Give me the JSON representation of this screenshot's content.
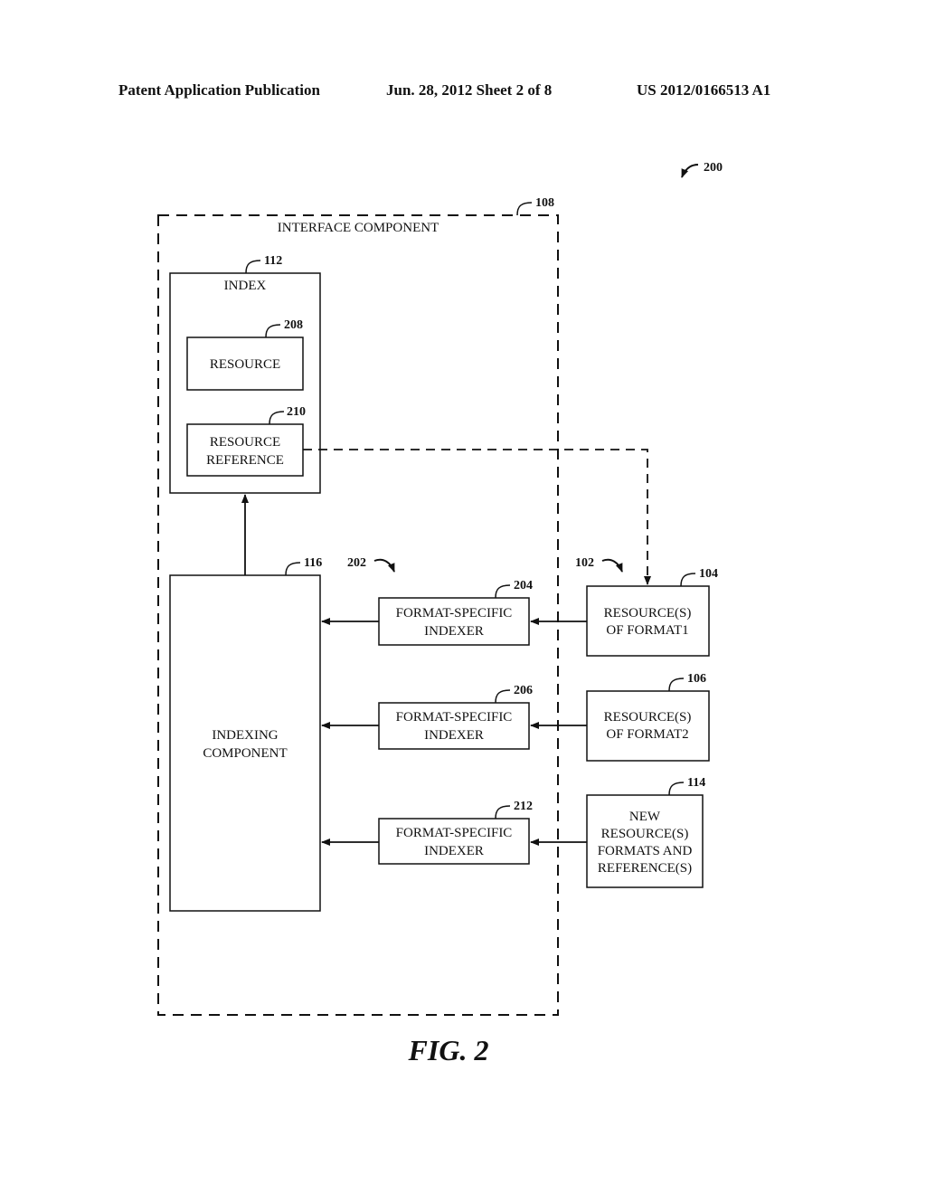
{
  "header": {
    "left": "Patent Application Publication",
    "middle": "Jun. 28, 2012  Sheet 2 of 8",
    "right": "US 2012/0166513 A1"
  },
  "figure": {
    "ref": "200",
    "caption": "FIG. 2",
    "interface_component": {
      "label": "INTERFACE COMPONENT",
      "ref": "108"
    },
    "index": {
      "label": "INDEX",
      "ref": "112"
    },
    "resource": {
      "label": "RESOURCE",
      "ref": "208"
    },
    "resource_reference": {
      "line1": "RESOURCE",
      "line2": "REFERENCE",
      "ref": "210"
    },
    "indexing_component": {
      "line1": "INDEXING",
      "line2": "COMPONENT",
      "ref": "116"
    },
    "indexer_group_ref": "202",
    "resource_group_ref": "102",
    "indexers": [
      {
        "line1": "FORMAT-SPECIFIC",
        "line2": "INDEXER",
        "ref": "204"
      },
      {
        "line1": "FORMAT-SPECIFIC",
        "line2": "INDEXER",
        "ref": "206"
      },
      {
        "line1": "FORMAT-SPECIFIC",
        "line2": "INDEXER",
        "ref": "212"
      }
    ],
    "resources": [
      {
        "lines": [
          "RESOURCE(S)",
          "OF FORMAT1"
        ],
        "ref": "104"
      },
      {
        "lines": [
          "RESOURCE(S)",
          "OF FORMAT2"
        ],
        "ref": "106"
      },
      {
        "lines": [
          "NEW",
          "RESOURCE(S)",
          "FORMATS AND",
          "REFERENCE(S)"
        ],
        "ref": "114"
      }
    ]
  }
}
